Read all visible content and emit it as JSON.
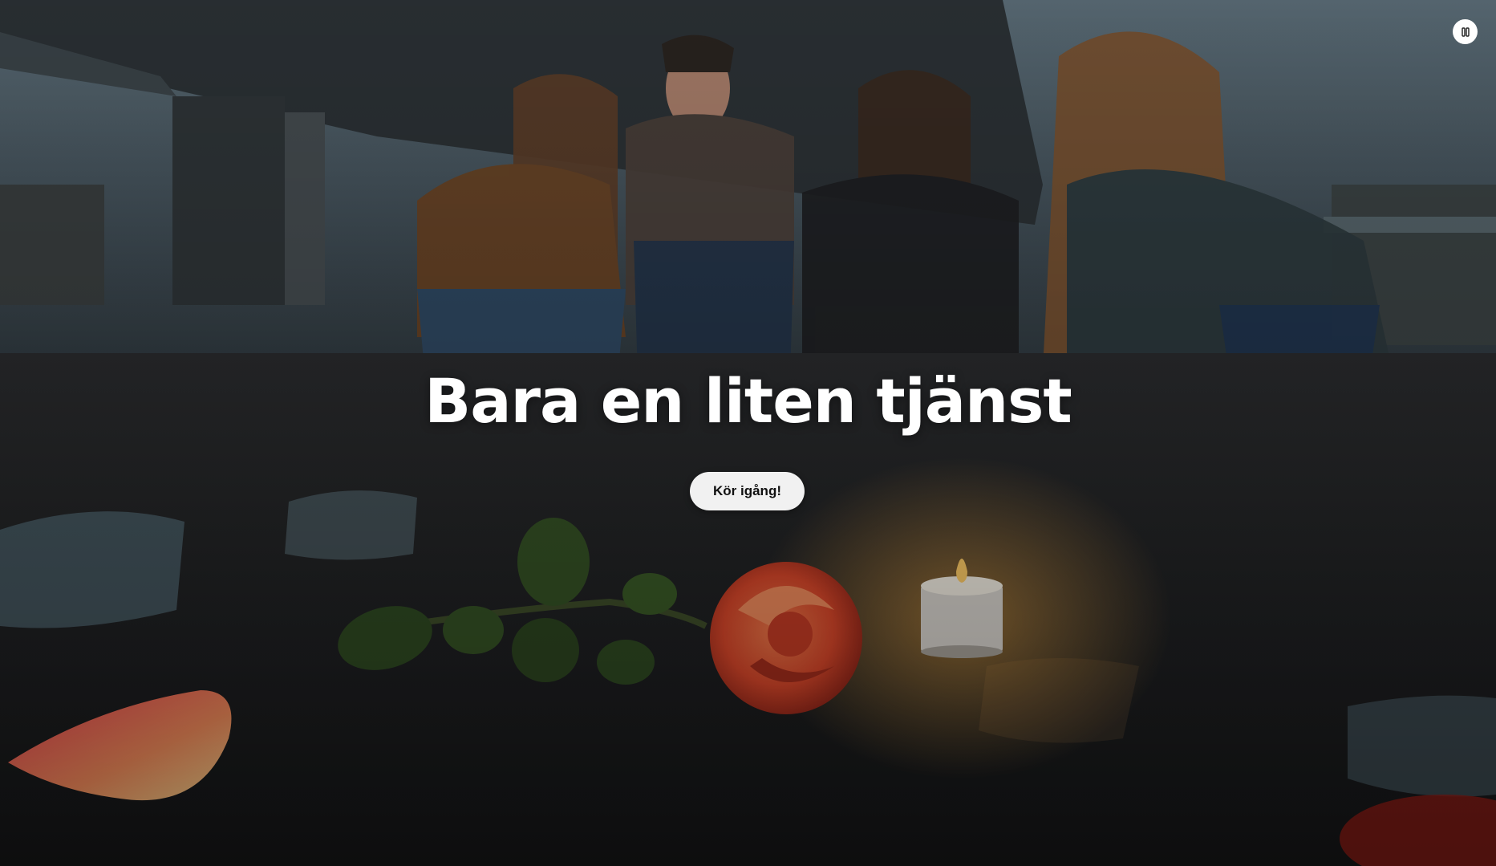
{
  "hero": {
    "title": "Bara en liten tjänst",
    "cta_label": "Kör igång!"
  },
  "controls": {
    "pause_icon": "pause-icon"
  },
  "colors": {
    "title_text": "#ffffff",
    "button_bg": "#f1f1f1",
    "button_text": "#111111",
    "candle_flame": "#ffb347",
    "rose": "#e0522e"
  }
}
